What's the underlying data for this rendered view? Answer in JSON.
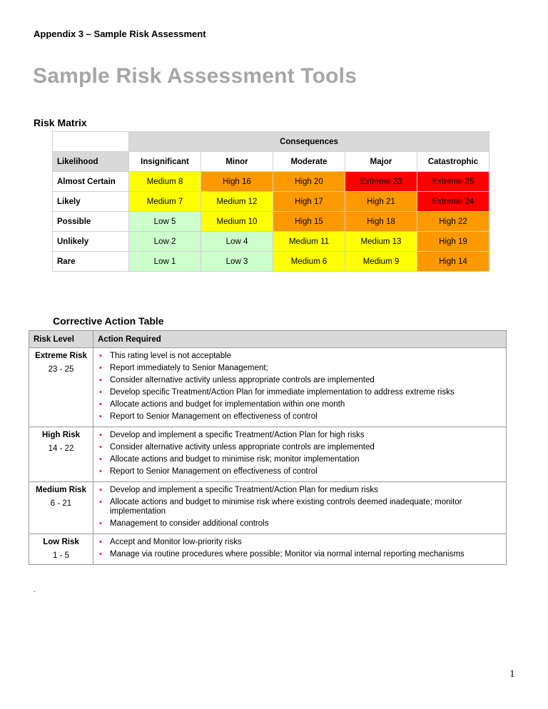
{
  "header": {
    "appendix": "Appendix 3 – Sample Risk Assessment",
    "title": "Sample Risk Assessment Tools"
  },
  "risk_matrix": {
    "heading": "Risk Matrix",
    "consequences_label": "Consequences",
    "likelihood_label": "Likelihood",
    "columns": [
      "Insignificant",
      "Minor",
      "Moderate",
      "Major",
      "Catastrophic"
    ],
    "level_colors": {
      "low": "#ccffcc",
      "medium": "#ffff00",
      "high": "#ff9900",
      "extreme": "#ff0000"
    },
    "rows": [
      {
        "label": "Almost Certain",
        "cells": [
          {
            "text": "Medium 8",
            "level": "medium"
          },
          {
            "text": "High 16",
            "level": "high"
          },
          {
            "text": "High 20",
            "level": "high"
          },
          {
            "text": "Extreme 23",
            "level": "extreme"
          },
          {
            "text": "Extreme 25",
            "level": "extreme"
          }
        ]
      },
      {
        "label": "Likely",
        "cells": [
          {
            "text": "Medium 7",
            "level": "medium"
          },
          {
            "text": "Medium 12",
            "level": "medium"
          },
          {
            "text": "High 17",
            "level": "high"
          },
          {
            "text": "High 21",
            "level": "high"
          },
          {
            "text": "Extreme 24",
            "level": "extreme"
          }
        ]
      },
      {
        "label": "Possible",
        "cells": [
          {
            "text": "Low 5",
            "level": "low"
          },
          {
            "text": "Medium 10",
            "level": "medium"
          },
          {
            "text": "High 15",
            "level": "high"
          },
          {
            "text": "High 18",
            "level": "high"
          },
          {
            "text": "High 22",
            "level": "high"
          }
        ]
      },
      {
        "label": "Unlikely",
        "cells": [
          {
            "text": "Low 2",
            "level": "low"
          },
          {
            "text": "Low 4",
            "level": "low"
          },
          {
            "text": "Medium 11",
            "level": "medium"
          },
          {
            "text": "Medium 13",
            "level": "medium"
          },
          {
            "text": "High 19",
            "level": "high"
          }
        ]
      },
      {
        "label": "Rare",
        "cells": [
          {
            "text": "Low 1",
            "level": "low"
          },
          {
            "text": "Low 3",
            "level": "low"
          },
          {
            "text": "Medium 6",
            "level": "medium"
          },
          {
            "text": "Medium 9",
            "level": "medium"
          },
          {
            "text": "High 14",
            "level": "high"
          }
        ]
      }
    ]
  },
  "corrective_action": {
    "heading": "Corrective Action Table",
    "col_level": "Risk Level",
    "col_action": "Action Required",
    "bullet_color": "#e8123c",
    "rows": [
      {
        "level": "Extreme Risk",
        "range": "23 - 25",
        "actions": [
          "This rating level is not acceptable",
          "Report immediately to Senior Management;",
          "Consider alternative activity unless appropriate controls are implemented",
          "Develop specific Treatment/Action Plan for immediate implementation to address extreme risks",
          "Allocate actions and budget for implementation within one month",
          "Report to Senior Management on effectiveness of control"
        ]
      },
      {
        "level": "High Risk",
        "range": "14 - 22",
        "actions": [
          "Develop and implement a specific Treatment/Action Plan for high risks",
          "Consider alternative activity unless appropriate controls are implemented",
          "Allocate actions and budget to minimise risk; monitor implementation",
          "Report to Senior Management on effectiveness of control"
        ]
      },
      {
        "level": "Medium Risk",
        "range": "6 - 21",
        "actions": [
          "Develop and implement a specific Treatment/Action Plan for medium risks",
          "Allocate actions and budget to minimise risk where existing controls deemed inadequate; monitor implementation",
          "Management to consider additional controls"
        ]
      },
      {
        "level": "Low Risk",
        "range": "1 - 5",
        "actions": [
          "Accept and Monitor low-priority risks",
          "Manage via routine procedures where possible; Monitor via normal internal reporting mechanisms"
        ]
      }
    ]
  },
  "footer": {
    "dot": ".",
    "page_number": "1"
  }
}
